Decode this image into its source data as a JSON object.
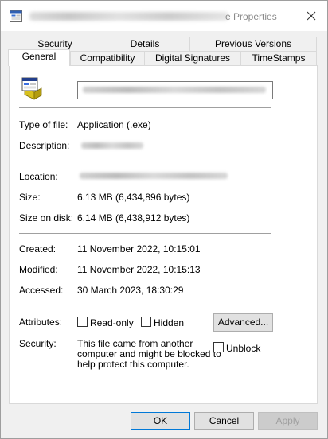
{
  "window": {
    "title_suffix": "e Properties",
    "close_label": "×"
  },
  "tabs_row1": [
    {
      "label": "Security"
    },
    {
      "label": "Details"
    },
    {
      "label": "Previous Versions"
    }
  ],
  "tabs_row2": [
    {
      "label": "General",
      "active": true
    },
    {
      "label": "Compatibility"
    },
    {
      "label": "Digital Signatures"
    },
    {
      "label": "TimeStamps"
    }
  ],
  "general": {
    "type_label": "Type of file:",
    "type_value": "Application (.exe)",
    "description_label": "Description:",
    "location_label": "Location:",
    "size_label": "Size:",
    "size_value": "6.13 MB (6,434,896 bytes)",
    "size_on_disk_label": "Size on disk:",
    "size_on_disk_value": "6.14 MB (6,438,912 bytes)",
    "created_label": "Created:",
    "created_value": "11 November 2022, 10:15:01",
    "modified_label": "Modified:",
    "modified_value": "11 November 2022, 10:15:13",
    "accessed_label": "Accessed:",
    "accessed_value": "30 March 2023, 18:30:29",
    "attributes_label": "Attributes:",
    "readonly_label": "Read-only",
    "hidden_label": "Hidden",
    "advanced_label": "Advanced...",
    "security_label": "Security:",
    "security_text_line1": "This file came from another",
    "security_text_line2": "computer and might be blocked to",
    "security_text_line3": "help protect this computer.",
    "unblock_label": "Unblock"
  },
  "buttons": {
    "ok": "OK",
    "cancel": "Cancel",
    "apply": "Apply"
  },
  "colors": {
    "accent": "#0078d7",
    "panel_bg": "#ffffff",
    "dialog_bg": "#f0f0f0"
  },
  "icons": {
    "title": "application-icon",
    "file": "application-icon",
    "close": "close-icon"
  }
}
